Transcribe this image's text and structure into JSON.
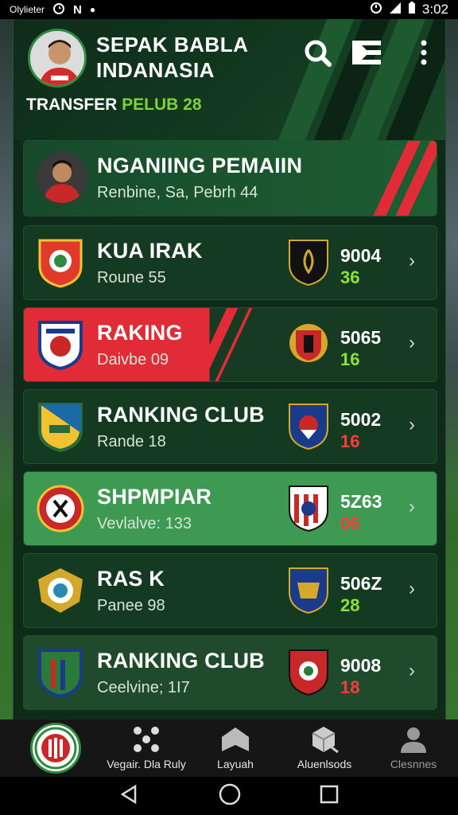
{
  "status_bar": {
    "carrier": "Olylieter",
    "time": "3:02"
  },
  "header": {
    "title": "SEPAK BABLA INDANASIA",
    "subtitle_white": "TRANSFER ",
    "subtitle_accent": "PELUB 28",
    "icons": [
      "search-icon",
      "news-icon",
      "more-vertical-icon"
    ]
  },
  "featured": {
    "name": "NGANIING PEMAIIN",
    "sub": "Renbine, Sa, Pebrh 44"
  },
  "rows": [
    {
      "name": "KUA IRAK",
      "sub": "Roune 55",
      "score1": "9004",
      "score2": "36",
      "score2_color": "green"
    },
    {
      "name": "RAKING",
      "sub": "Daivbe 09",
      "score1": "5065",
      "score2": "16",
      "score2_color": "green"
    },
    {
      "name": "RANKING CLUB",
      "sub": "Rande 18",
      "score1": "5002",
      "score2": "16",
      "score2_color": "red"
    },
    {
      "name": "SHPMPIAR",
      "sub": "Vevlalve: 133",
      "score1": "5Z63",
      "score2": "06",
      "score2_color": "red"
    },
    {
      "name": "RAS K",
      "sub": "Panee 98",
      "score1": "506Z",
      "score2": "28",
      "score2_color": "green"
    },
    {
      "name": "RANKING CLUB",
      "sub": "Ceelvine; 1I7",
      "score1": "9008",
      "score2": "18",
      "score2_color": "red"
    }
  ],
  "bottom_nav": {
    "items": [
      {
        "label": "Vegair. Dla Ruly",
        "icon": "dots-icon"
      },
      {
        "label": "Layuah",
        "icon": "home-icon"
      },
      {
        "label": "Aluenlsods",
        "icon": "box-icon"
      },
      {
        "label": "Clesnnes",
        "icon": "person-icon"
      }
    ]
  },
  "colors": {
    "accent_green": "#7fd13b",
    "brand_red": "#e12b36",
    "panel": "#0e2a18"
  }
}
